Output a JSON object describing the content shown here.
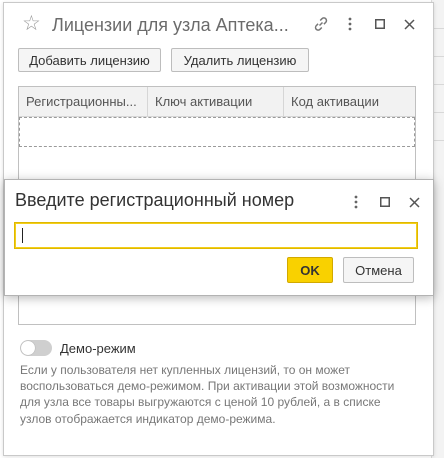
{
  "window": {
    "title": "Лицензии для узла Аптека...",
    "star_icon": "star-icon",
    "link_icon": "link-icon",
    "more_icon": "more-vertical-icon",
    "maximize_icon": "maximize-icon",
    "close_icon": "close-icon"
  },
  "toolbar": {
    "add_label": "Добавить лицензию",
    "remove_label": "Удалить лицензию"
  },
  "table": {
    "columns": [
      "Регистрационны...",
      "Ключ активации",
      "Код активации"
    ],
    "rows": []
  },
  "demo": {
    "label": "Демо-режим",
    "enabled": false,
    "hint": "Если у пользователя нет купленных лицензий, то он может воспользоваться демо-режимом. При активации этой возможности для узла все товары выгружаются с ценой 10 рублей, а в списке узлов отображается индикатор демо-режима."
  },
  "dialog": {
    "title": "Введите регистрационный номер",
    "input_value": "",
    "ok_label": "OK",
    "cancel_label": "Отмена",
    "more_icon": "more-vertical-icon",
    "maximize_icon": "maximize-icon",
    "close_icon": "close-icon"
  },
  "colors": {
    "accent": "#f9d100",
    "focus_border": "#e0b800"
  }
}
